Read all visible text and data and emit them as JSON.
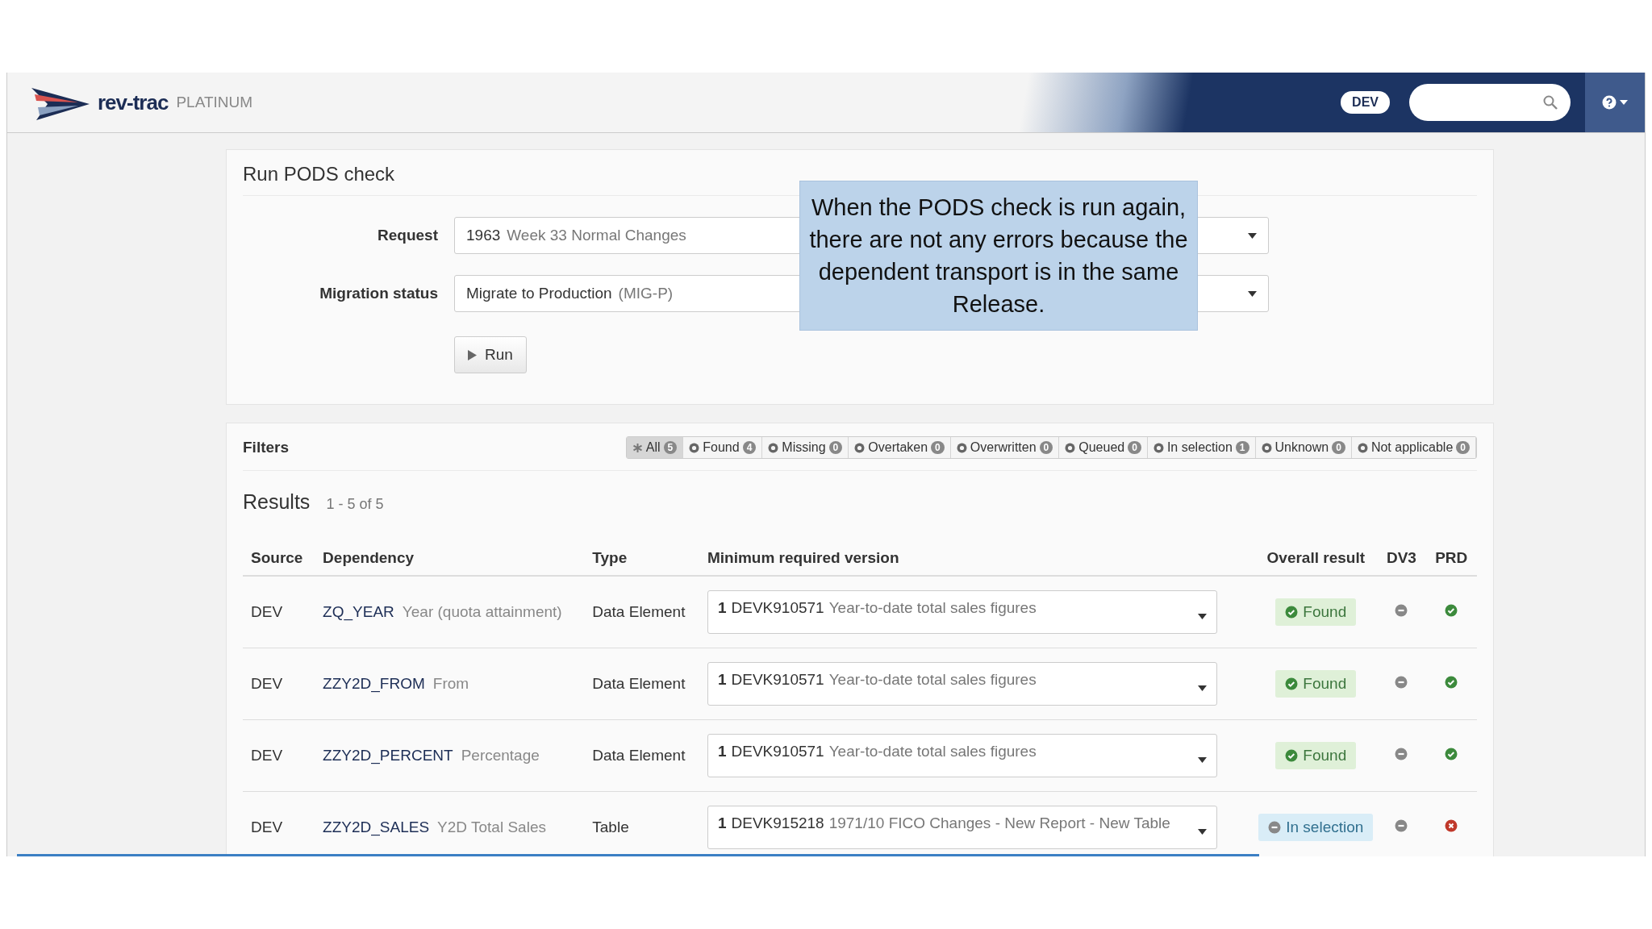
{
  "header": {
    "brand": "rev-trac",
    "edition": "PLATINUM",
    "system": "DEV"
  },
  "run_panel": {
    "title": "Run PODS check",
    "fields": [
      {
        "label": "Request",
        "number": "1963",
        "value": "Week 33 Normal Changes"
      },
      {
        "label": "Migration status",
        "number": "Migrate to Production",
        "value": "(MIG-P)"
      }
    ],
    "button": "Run"
  },
  "callout": "When the PODS check is run again, there are not any errors because the dependent transport is in the same Release.",
  "filters": {
    "title": "Filters",
    "items": [
      {
        "label": "All",
        "count": "5",
        "selected": true
      },
      {
        "label": "Found",
        "count": "4",
        "selected": false
      },
      {
        "label": "Missing",
        "count": "0",
        "selected": false
      },
      {
        "label": "Overtaken",
        "count": "0",
        "selected": false
      },
      {
        "label": "Overwritten",
        "count": "0",
        "selected": false
      },
      {
        "label": "Queued",
        "count": "0",
        "selected": false
      },
      {
        "label": "In selection",
        "count": "1",
        "selected": false
      },
      {
        "label": "Unknown",
        "count": "0",
        "selected": false
      },
      {
        "label": "Not applicable",
        "count": "0",
        "selected": false
      }
    ]
  },
  "results": {
    "title": "Results",
    "range": "1 - 5 of 5",
    "columns": [
      "Source",
      "Dependency",
      "Type",
      "Minimum required version",
      "Overall result",
      "DV3",
      "PRD"
    ],
    "rows": [
      {
        "source": "DEV",
        "name": "ZQ_YEAR",
        "desc": "Year (quota attainment)",
        "type": "Data Element",
        "ver_num": "1",
        "ver_id": "DEVK910571",
        "ver_desc": "Year-to-date total sales figures",
        "result": {
          "label": "Found",
          "kind": "found"
        },
        "dv3": {
          "kind": "neutral"
        },
        "prd": {
          "kind": "ok"
        }
      },
      {
        "source": "DEV",
        "name": "ZZY2D_FROM",
        "desc": "From",
        "type": "Data Element",
        "ver_num": "1",
        "ver_id": "DEVK910571",
        "ver_desc": "Year-to-date total sales figures",
        "result": {
          "label": "Found",
          "kind": "found"
        },
        "dv3": {
          "kind": "neutral"
        },
        "prd": {
          "kind": "ok"
        }
      },
      {
        "source": "DEV",
        "name": "ZZY2D_PERCENT",
        "desc": "Percentage",
        "type": "Data Element",
        "ver_num": "1",
        "ver_id": "DEVK910571",
        "ver_desc": "Year-to-date total sales figures",
        "result": {
          "label": "Found",
          "kind": "found"
        },
        "dv3": {
          "kind": "neutral"
        },
        "prd": {
          "kind": "ok"
        }
      },
      {
        "source": "DEV",
        "name": "ZZY2D_SALES",
        "desc": "Y2D Total Sales",
        "type": "Table",
        "ver_num": "1",
        "ver_id": "DEVK915218",
        "ver_desc": "1971/10 FICO Changes - New Report - New Table",
        "result": {
          "label": "In selection",
          "kind": "selection"
        },
        "dv3": {
          "kind": "neutral"
        },
        "prd": {
          "kind": "error"
        }
      }
    ]
  }
}
